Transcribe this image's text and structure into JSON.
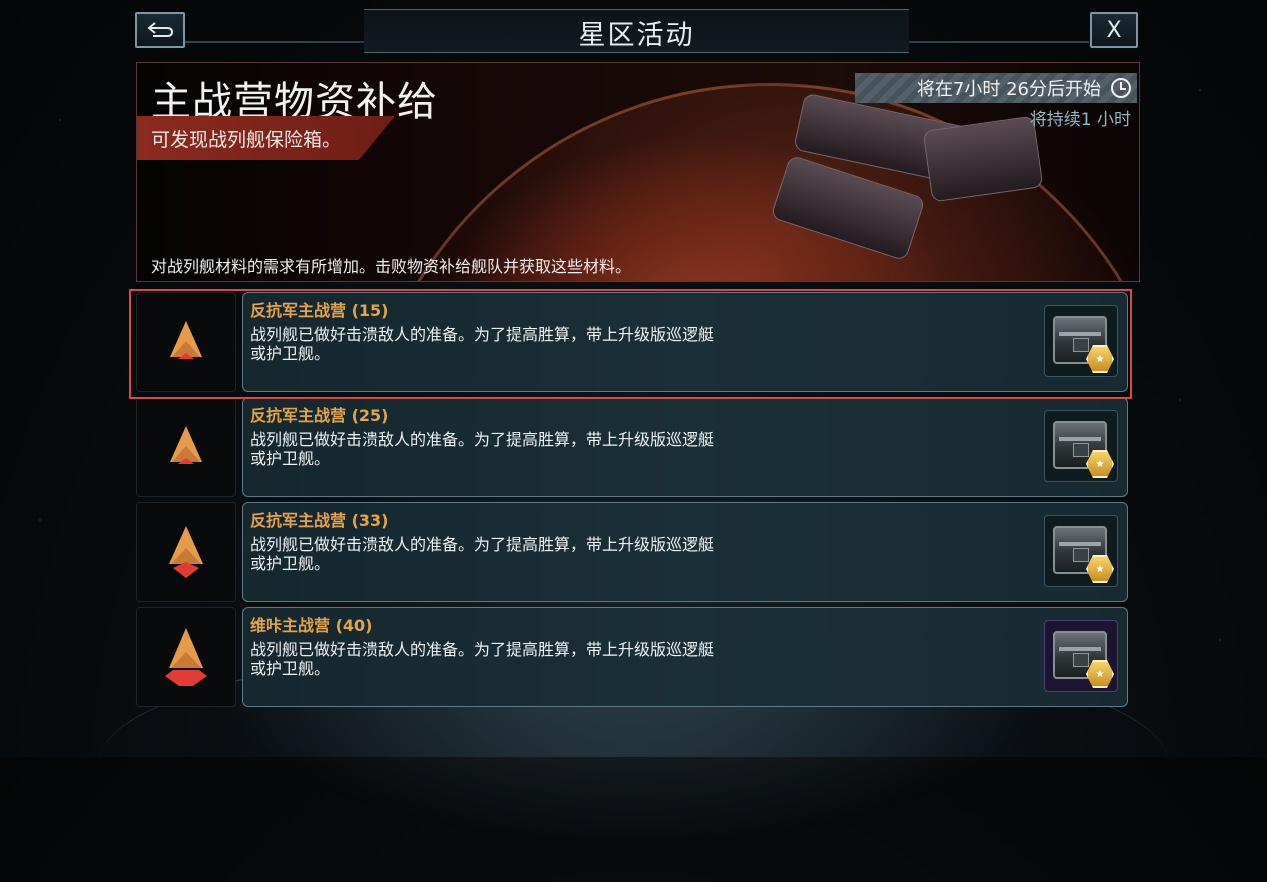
{
  "header": {
    "title": "星区活动",
    "back_icon": "back-arrow-icon",
    "close_label": "X"
  },
  "banner": {
    "title": "主战营物资补给",
    "subtitle": "可发现战列舰保险箱。",
    "timer_text": "将在7小时 26分后开始",
    "duration_text": "将持续1 小时",
    "description": "对战列舰材料的需求有所增加。击败物资补给舰队并获取这些材料。",
    "accent_color": "#8c2a1f"
  },
  "camps": [
    {
      "title": "反抗军主战营 (15)",
      "description": "战列舰已做好击溃敌人的准备。为了提高胜算，带上升级版巡逻艇或护卫舰。",
      "rank_icon": "rank-chevron-1-icon",
      "reward_icon": "battleship-chest-icon",
      "selected": true
    },
    {
      "title": "反抗军主战营 (25)",
      "description": "战列舰已做好击溃敌人的准备。为了提高胜算，带上升级版巡逻艇或护卫舰。",
      "rank_icon": "rank-chevron-1-icon",
      "reward_icon": "battleship-chest-icon",
      "selected": false
    },
    {
      "title": "反抗军主战营 (33)",
      "description": "战列舰已做好击溃敌人的准备。为了提高胜算，带上升级版巡逻艇或护卫舰。",
      "rank_icon": "rank-chevron-2-icon",
      "reward_icon": "battleship-chest-icon",
      "selected": false
    },
    {
      "title": "维咔主战营 (40)",
      "description": "战列舰已做好击溃敌人的准备。为了提高胜算，带上升级版巡逻艇或护卫舰。",
      "rank_icon": "rank-chevron-3-icon",
      "reward_icon": "battleship-chest-purple-icon",
      "selected": false
    }
  ],
  "colors": {
    "camp_title": "#e5a44a",
    "selection_outline": "#d94a43",
    "card_border": "#5c7b86"
  }
}
